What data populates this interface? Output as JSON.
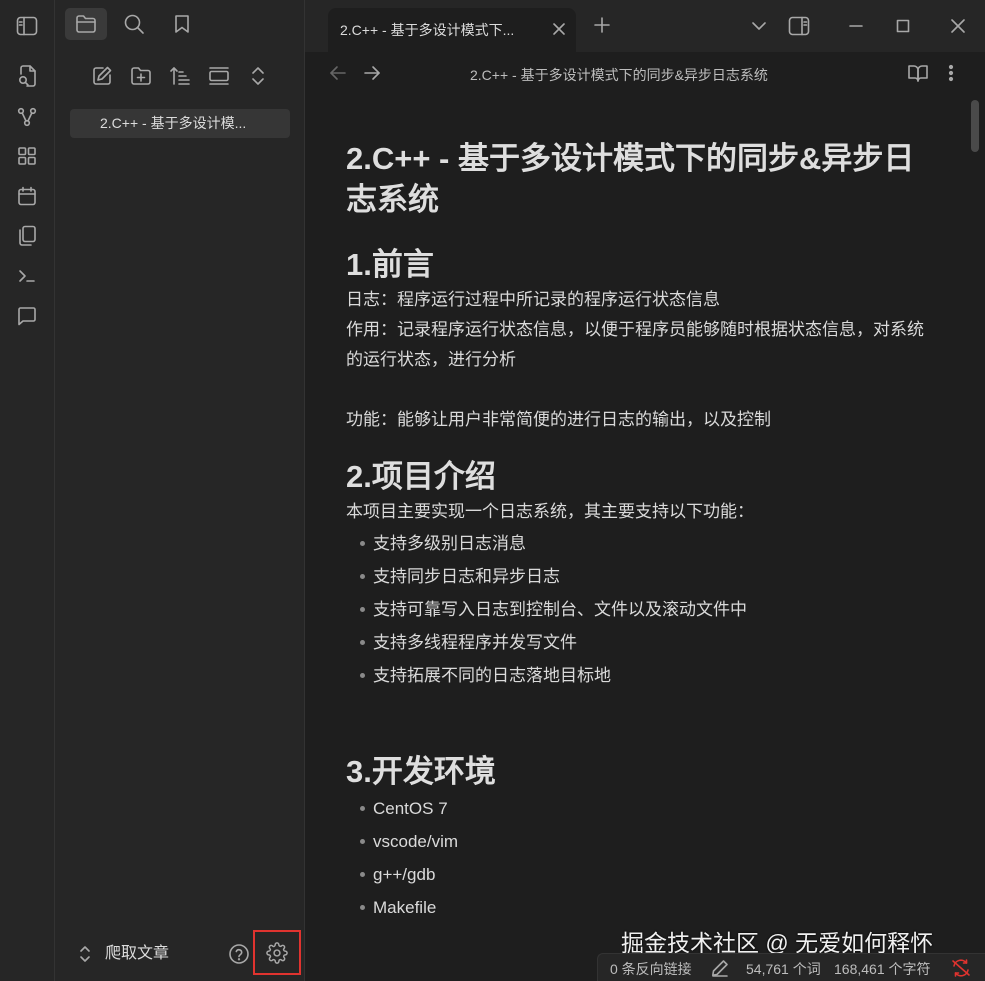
{
  "tab": {
    "title": "2.C++ - 基于多设计模式下..."
  },
  "view": {
    "title": "2.C++ - 基于多设计模式下的同步&异步日志系统"
  },
  "sidebar": {
    "file": "2.C++ - 基于多设计模...",
    "vault_name": "爬取文章"
  },
  "doc": {
    "title": "2.C++ - 基于多设计模式下的同步&异步日志系统",
    "s1": {
      "heading": "1.前言",
      "p1": "日志：程序运行过程中所记录的程序运行状态信息",
      "p2": "作用：记录程序运行状态信息，以便于程序员能够随时根据状态信息，对系统的运行状态，进行分析",
      "p3": "功能：能够让用户非常简便的进行日志的输出，以及控制"
    },
    "s2": {
      "heading": "2.项目介绍",
      "intro": "本项目主要实现一个日志系统，其主要支持以下功能：",
      "items": [
        "支持多级别日志消息",
        "支持同步日志和异步日志",
        "支持可靠写入日志到控制台、文件以及滚动文件中",
        "支持多线程程序并发写文件",
        "支持拓展不同的日志落地目标地"
      ]
    },
    "s3": {
      "heading": "3.开发环境",
      "items": [
        "CentOS 7",
        "vscode/vim",
        "g++/gdb",
        "Makefile"
      ]
    }
  },
  "watermark": "掘金技术社区 @ 无爱如何释怀",
  "status": {
    "backlinks": "0 条反向链接",
    "words": "54,761 个词",
    "chars": "168,461 个字符"
  },
  "colors": {
    "settings_highlight": "#e0332f",
    "sync_error": "#e0332f"
  }
}
